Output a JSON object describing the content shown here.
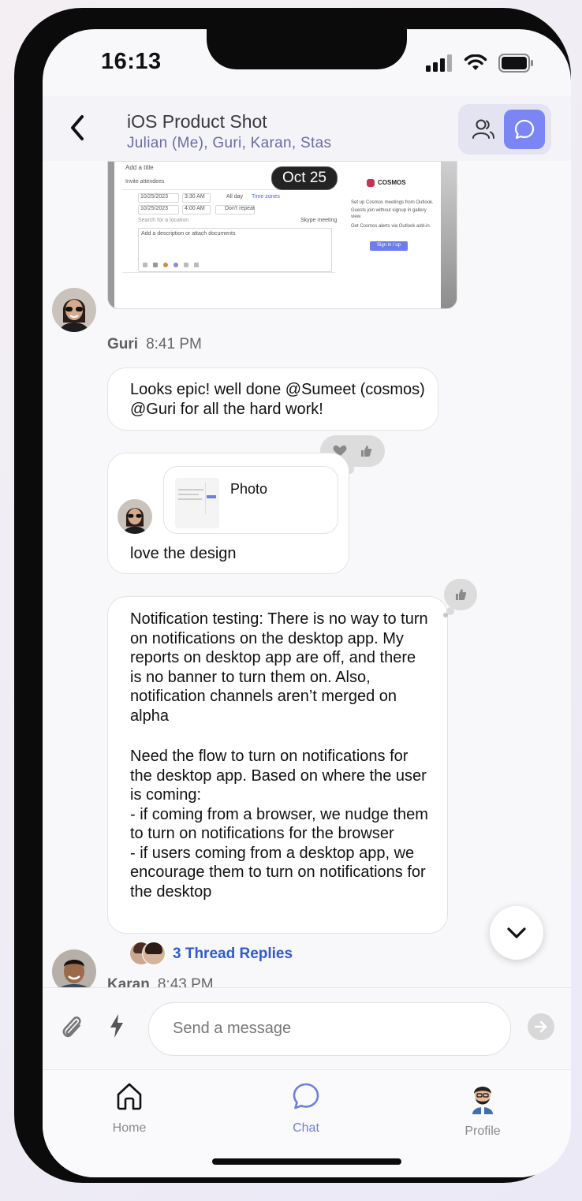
{
  "status_bar": {
    "time": "16:13"
  },
  "header": {
    "title": "iOS Product Shot",
    "participants": "Julian (Me), Guri, Karan, Stas"
  },
  "date_divider": "Oct 25",
  "attachment_preview": {
    "form_title": "Add a title",
    "invite": "Invite attendees",
    "date1": "10/25/2023",
    "time1": "3:30 AM",
    "allday": "All day",
    "timezones": "Time zones",
    "date2": "10/25/2023",
    "time2": "4:00 AM",
    "repeat": "Don't repeat",
    "location": "Search for a location",
    "skype": "Skype meeting",
    "description": "Add a description or attach documents",
    "brand": "COSMOS",
    "bullet1": "Set up Cosmos meetings from Outlook.",
    "bullet2": "Guests join without signup in gallery view.",
    "bullet3": "Get Cosmos alerts via Outlook add-in.",
    "signin": "Sign in / up"
  },
  "messages": [
    {
      "sender": "Guri",
      "time": "8:41 PM"
    },
    {
      "text": "Looks epic! well done @Sumeet (cosmos) @Guri for all the hard work!"
    },
    {
      "quote_label": "Photo",
      "text": "love the design"
    },
    {
      "para1": "Notification testing: There is no way to turn on notifications on the desktop app. My reports on desktop app are off, and there is no banner to turn them on. Also, notification channels aren’t merged on alpha",
      "para2": "Need the flow to turn on notifications for the desktop app. Based on where the user is coming:",
      "line3": "- if coming from a browser, we nudge them to turn on notifications for the browser",
      "line4": "- if users coming from a desktop app, we encourage them to turn on notifications for the desktop",
      "thread_replies": "3 Thread Replies"
    },
    {
      "sender": "Karan",
      "time": "8:43 PM"
    }
  ],
  "composer": {
    "placeholder": "Send a message"
  },
  "tabs": [
    {
      "label": "Home"
    },
    {
      "label": "Chat"
    },
    {
      "label": "Profile"
    }
  ],
  "colors": {
    "accent": "#7b86f4",
    "link": "#2f5bd0",
    "active_tab": "#6f7fdc"
  }
}
